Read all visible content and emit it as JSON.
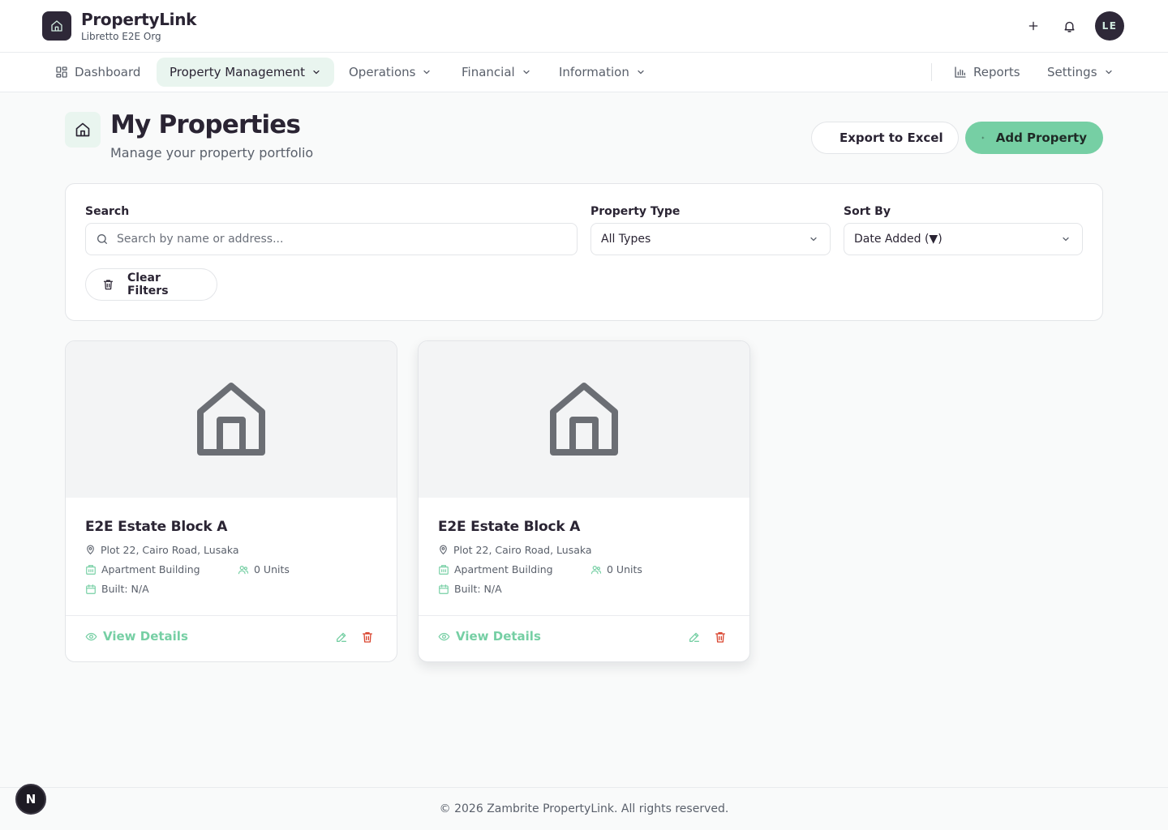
{
  "brand": {
    "name": "PropertyLink",
    "org": "Libretto E2E Org",
    "avatar_initials": "LE"
  },
  "header_icons": [
    "plus-icon",
    "bell-icon"
  ],
  "nav": {
    "items": [
      {
        "label": "Dashboard",
        "icon": "grid-icon",
        "dropdown": false,
        "active": false
      },
      {
        "label": "Property Management",
        "dropdown": true,
        "active": true
      },
      {
        "label": "Operations",
        "dropdown": true,
        "active": false
      },
      {
        "label": "Financial",
        "dropdown": true,
        "active": false
      },
      {
        "label": "Information",
        "dropdown": true,
        "active": false
      }
    ],
    "right": [
      {
        "label": "Reports",
        "icon": "bar-chart-icon",
        "dropdown": false
      },
      {
        "label": "Settings",
        "dropdown": true
      }
    ]
  },
  "page": {
    "title": "My Properties",
    "subtitle": "Manage your property portfolio",
    "export_label": "Export to Excel",
    "add_label": "Add Property"
  },
  "filters": {
    "search_label": "Search",
    "search_placeholder": "Search by name or address...",
    "type_label": "Property Type",
    "type_value": "All Types",
    "sort_label": "Sort By",
    "sort_value": "Date Added (▼)",
    "clear_label": "Clear Filters"
  },
  "properties": [
    {
      "name": "E2E Estate Block A",
      "address": "Plot 22, Cairo Road, Lusaka",
      "type": "Apartment Building",
      "units": "0 Units",
      "built": "Built: N/A",
      "view_label": "View Details"
    },
    {
      "name": "E2E Estate Block A",
      "address": "Plot 22, Cairo Road, Lusaka",
      "type": "Apartment Building",
      "units": "0 Units",
      "built": "Built: N/A",
      "view_label": "View Details"
    }
  ],
  "footer": {
    "text": "© 2026 Zambrite PropertyLink. All rights reserved.",
    "badge": "N"
  },
  "colors": {
    "brand_dark": "#2e2838",
    "accent_green": "#76cfa4",
    "accent_green_light": "#e9f5ef",
    "danger": "#d9452f",
    "page_bg": "#f9fafa"
  }
}
